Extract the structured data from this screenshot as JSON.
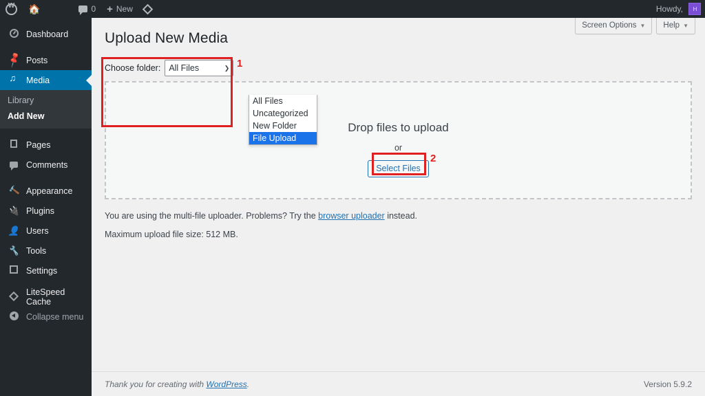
{
  "adminbar": {
    "logo_icon": "wordpress-logo-icon",
    "home_icon": "home-icon",
    "comments_icon": "comment-bubble-icon",
    "comments_count": "0",
    "new_icon": "plus-icon",
    "new_label": "New",
    "litespeed_icon": "litespeed-diamond-icon",
    "howdy": "Howdy,",
    "avatar_initial": "H"
  },
  "sidebar": {
    "items": [
      {
        "label": "Dashboard",
        "icon": "dashboard-icon"
      },
      {
        "label": "Posts",
        "icon": "pin-icon"
      },
      {
        "label": "Media",
        "icon": "media-icon",
        "active": true
      },
      {
        "label": "Pages",
        "icon": "pages-icon"
      },
      {
        "label": "Comments",
        "icon": "comments-icon"
      },
      {
        "label": "Appearance",
        "icon": "appearance-brush-icon"
      },
      {
        "label": "Plugins",
        "icon": "plugins-plug-icon"
      },
      {
        "label": "Users",
        "icon": "users-icon"
      },
      {
        "label": "Tools",
        "icon": "tools-wrench-icon"
      },
      {
        "label": "Settings",
        "icon": "settings-sliders-icon"
      },
      {
        "label": "LiteSpeed Cache",
        "icon": "litespeed-diamond-icon"
      },
      {
        "label": "Collapse menu",
        "icon": "collapse-arrow-icon"
      }
    ],
    "media_submenu": [
      {
        "label": "Library",
        "current": false
      },
      {
        "label": "Add New",
        "current": true
      }
    ]
  },
  "screen_meta": {
    "screen_options_label": "Screen Options",
    "help_label": "Help",
    "caret_icon": "chevron-down-icon"
  },
  "main": {
    "page_title": "Upload New Media",
    "folder": {
      "label": "Choose folder:",
      "selected": "All Files",
      "caret_icon": "chevron-down-icon",
      "options": [
        {
          "label": "All Files",
          "selected": false
        },
        {
          "label": "Uncategorized",
          "selected": false
        },
        {
          "label": "New Folder",
          "selected": false
        },
        {
          "label": "File Upload",
          "selected": true
        }
      ]
    },
    "dropzone": {
      "title": "Drop files to upload",
      "or": "or",
      "select_files_label": "Select Files"
    },
    "notes": {
      "uploader_text_before": "You are using the multi-file uploader. Problems? Try the ",
      "uploader_link": "browser uploader",
      "uploader_text_after": " instead.",
      "max_size": "Maximum upload file size: 512 MB."
    }
  },
  "footer": {
    "thanks_before": "Thank you for creating with ",
    "thanks_link": "WordPress",
    "thanks_after": ".",
    "version": "Version 5.9.2"
  },
  "annotations": {
    "step1": "1",
    "step2": "2",
    "color": "#e02020"
  }
}
